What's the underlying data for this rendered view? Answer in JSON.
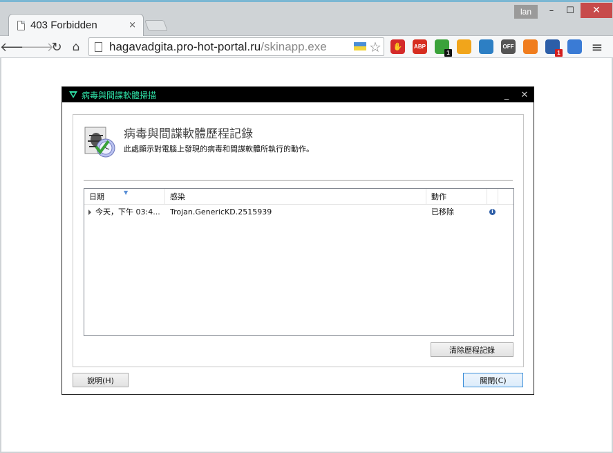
{
  "browser": {
    "tab_title": "403 Forbidden",
    "tab_close": "×",
    "user_name": "lan",
    "url_host": "hagavadgita.pro-hot-portal.ru",
    "url_path": "/skinapp.exe",
    "window_controls": {
      "minimize": "–",
      "maximize": "☐",
      "close": "✕"
    },
    "extensions": [
      {
        "name": "stop-icon",
        "color": "#d42a2a",
        "label": "✋"
      },
      {
        "name": "adblock-plus-icon",
        "color": "#d62d20",
        "label": "ABP"
      },
      {
        "name": "ghostery-icon",
        "color": "#3aa23a",
        "label": "",
        "badge": "1"
      },
      {
        "name": "chameleon-icon",
        "color": "#f1a51b",
        "label": ""
      },
      {
        "name": "weather-icon",
        "color": "#2d7fc4",
        "label": ""
      },
      {
        "name": "off-toggle-icon",
        "color": "#555555",
        "label": "OFF"
      },
      {
        "name": "dots-icon",
        "color": "#f07d1e",
        "label": ""
      },
      {
        "name": "notification-icon",
        "color": "#2c5ea8",
        "label": "",
        "badge": "1"
      },
      {
        "name": "sync-icon",
        "color": "#3a7bd5",
        "label": ""
      }
    ],
    "menu_icon": "≡"
  },
  "dialog": {
    "title": "病毒與間諜軟體掃描",
    "header_title": "病毒與間諜軟體歷程記錄",
    "header_desc": "此處顯示對電腦上發現的病毒和間諜軟體所執行的動作。",
    "columns": {
      "date": "日期",
      "infection": "感染",
      "action": "動作"
    },
    "rows": [
      {
        "date": "今天，下午 03:4...",
        "infection": "Trojan.GenericKD.2515939",
        "action": "已移除"
      }
    ],
    "buttons": {
      "clear_history": "清除歷程記錄",
      "help": "說明(H)",
      "close": "關閉(C)"
    },
    "controls": {
      "minimize": "_",
      "close": "✕"
    },
    "accent_color": "#2fe0a6"
  }
}
